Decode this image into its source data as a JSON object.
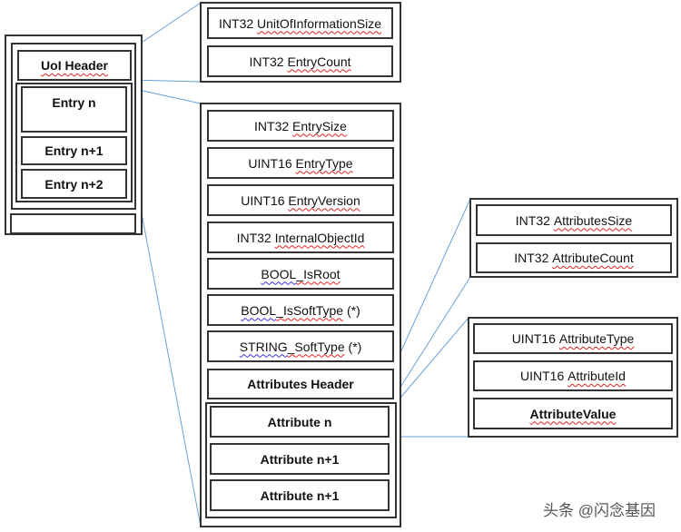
{
  "uoi": {
    "header": "UoI Header",
    "entries": [
      "Entry n",
      "Entry n+1",
      "Entry n+2"
    ]
  },
  "uoi_header_fields": [
    {
      "type": "INT32",
      "name": "UnitOfInformationSize"
    },
    {
      "type": "INT32",
      "name": "EntryCount"
    }
  ],
  "entry_fields": [
    {
      "type": "INT32",
      "name": "EntrySize"
    },
    {
      "type": "UINT16",
      "name": "EntryType"
    },
    {
      "type": "UINT16",
      "name": "EntryVersion"
    },
    {
      "type": "INT32",
      "name": "InternalObjectId"
    },
    {
      "type": "BOOL",
      "name": "IsRoot"
    },
    {
      "type": "BOOL",
      "name": "IsSoftType",
      "suffix": "(*)"
    },
    {
      "type": "STRING",
      "name": "SoftType",
      "suffix": "(*)"
    }
  ],
  "attributes_header": "Attributes Header",
  "attributes": [
    "Attribute n",
    "Attribute n+1",
    "Attribute n+1"
  ],
  "attributes_header_fields": [
    {
      "type": "INT32",
      "name": "AttributesSize"
    },
    {
      "type": "INT32",
      "name": "AttributeCount"
    }
  ],
  "attribute_fields": [
    {
      "type": "UINT16",
      "name": "AttributeType"
    },
    {
      "type": "UINT16",
      "name": "AttributeId"
    },
    {
      "type": "",
      "name": "AttributeValue"
    }
  ],
  "watermark": "头条 @闪念基因",
  "colors": {
    "connector": "#6a9fd4",
    "border": "#333333",
    "spellcheck": "#dd2222"
  }
}
